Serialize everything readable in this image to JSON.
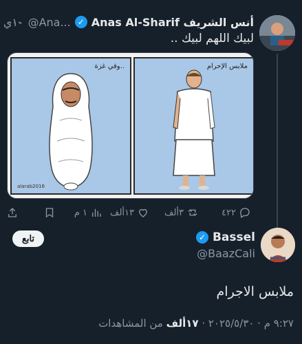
{
  "tweet1": {
    "name": "أنس الشريف Anas Al-Sharif",
    "handle": "@Ana...",
    "time": "۱۰ي",
    "more": "...",
    "text": "لبيك اللهم لبيك ..",
    "media": {
      "left_caption": "..وفي غزة",
      "right_caption": "ملابس الإحرام",
      "credit": "alarab2016"
    },
    "actions": {
      "replies": "٤٢٢",
      "reposts": "٣ألف",
      "likes": "١٣ألف",
      "views": "١ م"
    }
  },
  "tweet2": {
    "name": "Bassel",
    "handle": "@BaazCali",
    "follow_label": "تابع",
    "text": "ملابس الاجرام",
    "meta_time": "٩:٢٧ م · ٢٠٢٥/٥/٣٠ · ",
    "meta_views": "١٧ألف",
    "meta_views_label": " من المشاهدات"
  },
  "colors": {
    "background": "#15202b",
    "accent": "#1d9bf0",
    "muted": "#8b98a5",
    "text": "#e7e9ea"
  },
  "icons": [
    "more-icon",
    "verified-icon",
    "reply-icon",
    "repost-icon",
    "like-icon",
    "views-icon",
    "bookmark-icon",
    "share-icon"
  ]
}
